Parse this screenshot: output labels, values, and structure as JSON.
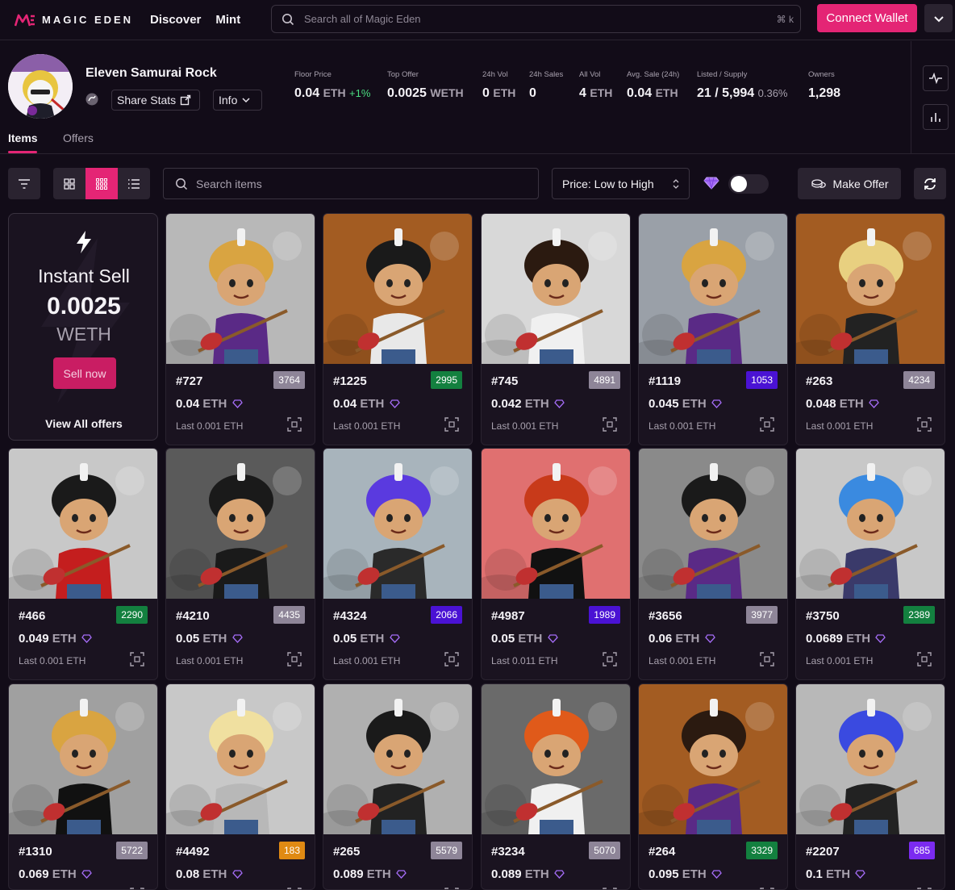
{
  "brand": {
    "logo_text": "MAGIC EDEN",
    "accent": "#e42575"
  },
  "nav": {
    "discover": "Discover",
    "mint": "Mint"
  },
  "search": {
    "placeholder": "Search all of Magic Eden",
    "shortcut": "⌘ k"
  },
  "connect_wallet": "Connect Wallet",
  "collection": {
    "name": "Eleven Samurai Rock",
    "share_stats": "Share Stats",
    "info": "Info",
    "stats": {
      "floor_price": {
        "label": "Floor Price",
        "value": "0.04",
        "unit": "ETH",
        "change": "+1%"
      },
      "top_offer": {
        "label": "Top Offer",
        "value": "0.0025",
        "unit": "WETH"
      },
      "vol_24h": {
        "label": "24h Vol",
        "value": "0",
        "unit": "ETH"
      },
      "sales_24h": {
        "label": "24h Sales",
        "value": "0"
      },
      "all_vol": {
        "label": "All Vol",
        "value": "4",
        "unit": "ETH"
      },
      "avg_sale": {
        "label": "Avg. Sale (24h)",
        "value": "0.04",
        "unit": "ETH"
      },
      "listed_supply": {
        "label": "Listed / Supply",
        "value": "21 / 5,994",
        "pct": "0.36%"
      },
      "owners": {
        "label": "Owners",
        "value": "1,298"
      }
    }
  },
  "tabs": {
    "items": "Items",
    "offers": "Offers"
  },
  "toolbar": {
    "search_placeholder": "Search items",
    "sort": "Price: Low to High",
    "make_offer": "Make Offer"
  },
  "instant_sell": {
    "title": "Instant Sell",
    "value": "0.0025",
    "unit": "WETH",
    "button": "Sell now",
    "view_all": "View All offers"
  },
  "rank_colors": {
    "gray": "#8e8598",
    "green": "#13803f",
    "blue": "#4a12d4",
    "orange": "#e08a13",
    "purple": "#7b2bf0"
  },
  "cards": [
    {
      "name": "#727",
      "rank": "3764",
      "rank_color": "#8e8598",
      "price": "0.04",
      "unit": "ETH",
      "last": "Last 0.001 ETH",
      "bg": "#b8b8b8",
      "hair": "#d9a441",
      "shirt": "#5a2a86"
    },
    {
      "name": "#1225",
      "rank": "2995",
      "rank_color": "#13803f",
      "price": "0.04",
      "unit": "ETH",
      "last": "Last 0.001 ETH",
      "bg": "#a35c22",
      "hair": "#1a1a1a",
      "shirt": "#e8e8e8"
    },
    {
      "name": "#745",
      "rank": "4891",
      "rank_color": "#8e8598",
      "price": "0.042",
      "unit": "ETH",
      "last": "Last 0.001 ETH",
      "bg": "#d8d8d8",
      "hair": "#2b1a10",
      "shirt": "#f0f0f0"
    },
    {
      "name": "#1119",
      "rank": "1053",
      "rank_color": "#4a12d4",
      "price": "0.045",
      "unit": "ETH",
      "last": "Last 0.001 ETH",
      "bg": "#9aa0a8",
      "hair": "#d9a441",
      "shirt": "#5a2a86"
    },
    {
      "name": "#263",
      "rank": "4234",
      "rank_color": "#8e8598",
      "price": "0.048",
      "unit": "ETH",
      "last": "Last 0.001 ETH",
      "bg": "#a35c22",
      "hair": "#e8d080",
      "shirt": "#222222"
    },
    {
      "name": "#466",
      "rank": "2290",
      "rank_color": "#13803f",
      "price": "0.049",
      "unit": "ETH",
      "last": "Last 0.001 ETH",
      "bg": "#c8c8c8",
      "hair": "#1a1a1a",
      "shirt": "#c41e1e"
    },
    {
      "name": "#4210",
      "rank": "4435",
      "rank_color": "#8e8598",
      "price": "0.05",
      "unit": "ETH",
      "last": "Last 0.001 ETH",
      "bg": "#5a5a5a",
      "hair": "#1a1a1a",
      "shirt": "#1a1a1a"
    },
    {
      "name": "#4324",
      "rank": "2066",
      "rank_color": "#4a12d4",
      "price": "0.05",
      "unit": "ETH",
      "last": "Last 0.001 ETH",
      "bg": "#a8b4bc",
      "hair": "#5a3adf",
      "shirt": "#2a2a2a"
    },
    {
      "name": "#4987",
      "rank": "1989",
      "rank_color": "#4a12d4",
      "price": "0.05",
      "unit": "ETH",
      "last": "Last 0.011 ETH",
      "bg": "#e07070",
      "hair": "#c83a1a",
      "shirt": "#111111"
    },
    {
      "name": "#3656",
      "rank": "3977",
      "rank_color": "#8e8598",
      "price": "0.06",
      "unit": "ETH",
      "last": "Last 0.001 ETH",
      "bg": "#8a8a8a",
      "hair": "#1a1a1a",
      "shirt": "#5a2a86"
    },
    {
      "name": "#3750",
      "rank": "2389",
      "rank_color": "#13803f",
      "price": "0.0689",
      "unit": "ETH",
      "last": "Last 0.001 ETH",
      "bg": "#c8c8c8",
      "hair": "#3a8ae0",
      "shirt": "#3a3a6a"
    },
    {
      "name": "#1310",
      "rank": "5722",
      "rank_color": "#8e8598",
      "price": "0.069",
      "unit": "ETH",
      "last": "Last 0.001 ETH",
      "bg": "#a0a0a0",
      "hair": "#d9a441",
      "shirt": "#111111"
    },
    {
      "name": "#4492",
      "rank": "183",
      "rank_color": "#e08a13",
      "price": "0.08",
      "unit": "ETH",
      "last": "",
      "bg": "#c8c8c8",
      "hair": "#f0e0a0",
      "shirt": "#b8b8b8"
    },
    {
      "name": "#265",
      "rank": "5579",
      "rank_color": "#8e8598",
      "price": "0.089",
      "unit": "ETH",
      "last": "",
      "bg": "#b0b0b0",
      "hair": "#1a1a1a",
      "shirt": "#222222"
    },
    {
      "name": "#3234",
      "rank": "5070",
      "rank_color": "#8e8598",
      "price": "0.089",
      "unit": "ETH",
      "last": "",
      "bg": "#6a6a6a",
      "hair": "#e05a1a",
      "shirt": "#f0f0f0"
    },
    {
      "name": "#264",
      "rank": "3329",
      "rank_color": "#13803f",
      "price": "0.095",
      "unit": "ETH",
      "last": "",
      "bg": "#a35c22",
      "hair": "#2b1a10",
      "shirt": "#5a2a86"
    },
    {
      "name": "#2207",
      "rank": "685",
      "rank_color": "#7b2bf0",
      "price": "0.1",
      "unit": "ETH",
      "last": "",
      "bg": "#b8b8b8",
      "hair": "#3a4ae0",
      "shirt": "#222222"
    }
  ]
}
